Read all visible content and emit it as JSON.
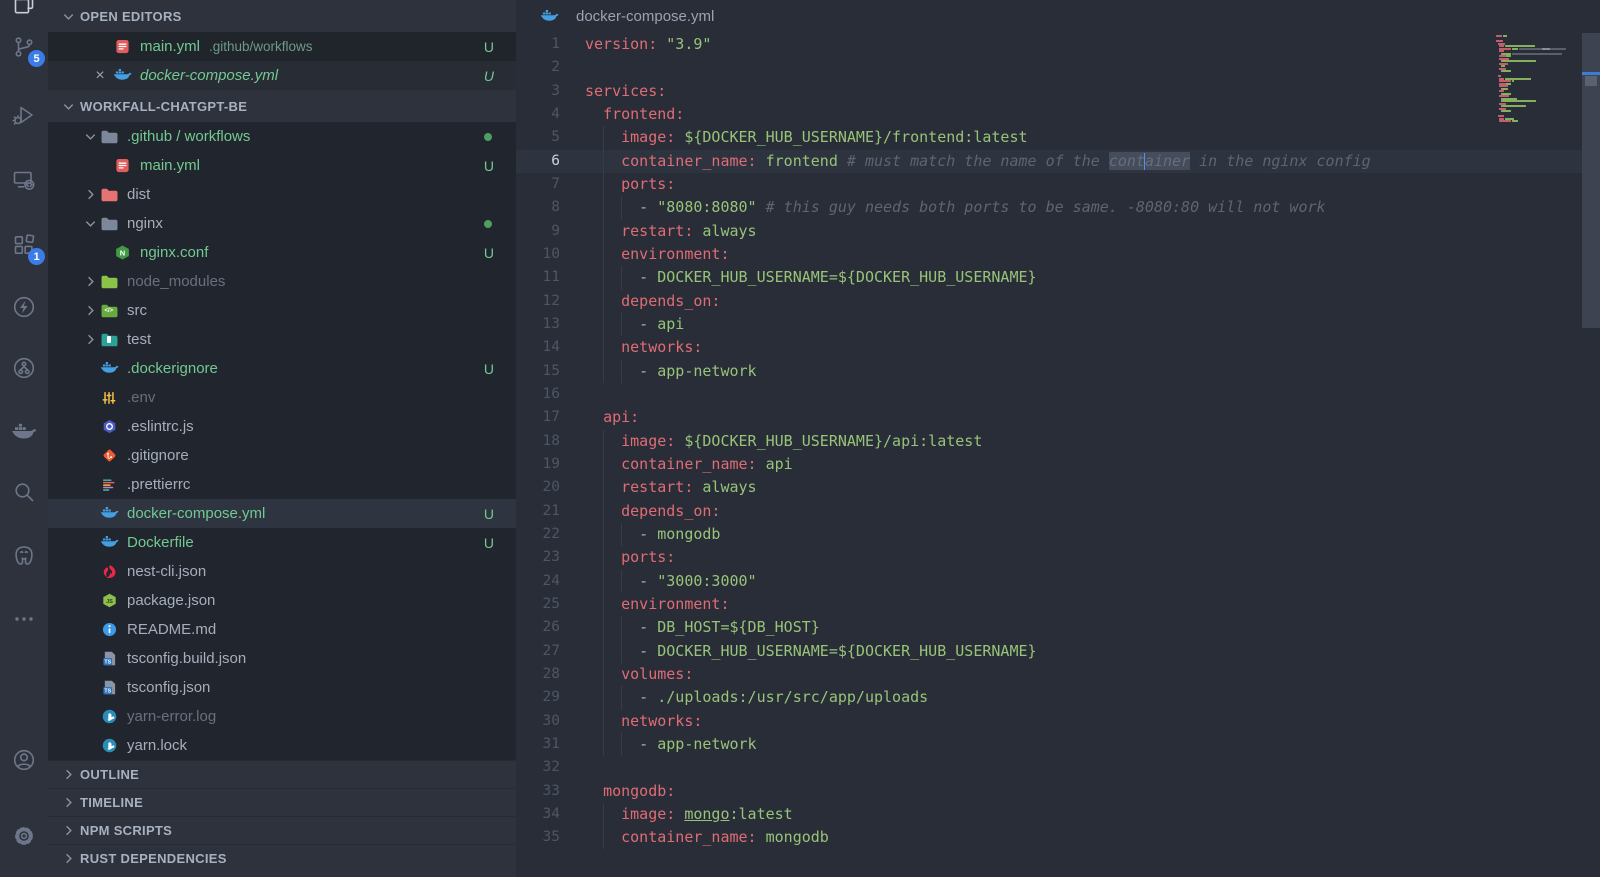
{
  "colors": {
    "accent": "#3b7de8",
    "untracked_green": "#73c991",
    "modified_dot": "#4e9e63",
    "cursor_blue": "#4e8fff",
    "key_red": "#e06c75",
    "value_green": "#98c379"
  },
  "activity_bar": {
    "items": [
      {
        "icon": "files-icon",
        "active": true
      },
      {
        "icon": "source-control-icon",
        "badge": "5"
      },
      {
        "icon": "run-debug-icon"
      },
      {
        "icon": "remote-explorer-icon"
      },
      {
        "icon": "extensions-icon",
        "badge": "1"
      },
      {
        "icon": "thunder-client-icon"
      },
      {
        "icon": "gitlens-icon"
      },
      {
        "icon": "docker-icon"
      },
      {
        "icon": "search-icon"
      },
      {
        "icon": "postgresql-icon"
      },
      {
        "icon": "more-icon"
      },
      {
        "icon": "account-icon"
      },
      {
        "icon": "settings-gear-icon"
      }
    ]
  },
  "sidebar": {
    "open_editors_header": "OPEN EDITORS",
    "project_header": "WORKFALL-CHATGPT-BE",
    "close_glyph": "×",
    "open_editors": [
      {
        "name": "main.yml",
        "description": ".github/workflows",
        "icon": "yaml",
        "badge": "U",
        "state": "untracked"
      },
      {
        "name": "docker-compose.yml",
        "icon": "docker",
        "badge": "U",
        "state": "untracked",
        "italic": true,
        "active": true,
        "closable": true
      }
    ],
    "tree": [
      {
        "label": ".github / workflows",
        "type": "folder",
        "icon": "folder-github",
        "expanded": true,
        "dot": true,
        "state": "untracked",
        "depth": 0
      },
      {
        "label": "main.yml",
        "type": "file",
        "icon": "yaml",
        "badge": "U",
        "state": "untracked",
        "depth": 1
      },
      {
        "label": "dist",
        "type": "folder",
        "icon": "folder-dist",
        "expanded": false,
        "state": "normal",
        "depth": 0
      },
      {
        "label": "nginx",
        "type": "folder",
        "icon": "folder-nginx",
        "expanded": true,
        "dot": true,
        "state": "normal",
        "depth": 0
      },
      {
        "label": "nginx.conf",
        "type": "file",
        "icon": "nginx",
        "badge": "U",
        "state": "untracked",
        "depth": 1
      },
      {
        "label": "node_modules",
        "type": "folder",
        "icon": "folder-node",
        "expanded": false,
        "state": "ignored",
        "depth": 0
      },
      {
        "label": "src",
        "type": "folder",
        "icon": "folder-src",
        "expanded": false,
        "state": "normal",
        "depth": 0
      },
      {
        "label": "test",
        "type": "folder",
        "icon": "folder-test",
        "expanded": false,
        "state": "normal",
        "depth": 0
      },
      {
        "label": ".dockerignore",
        "type": "file",
        "icon": "docker",
        "badge": "U",
        "state": "untracked",
        "depth": 0
      },
      {
        "label": ".env",
        "type": "file",
        "icon": "env",
        "state": "ignored",
        "depth": 0
      },
      {
        "label": ".eslintrc.js",
        "type": "file",
        "icon": "eslint",
        "state": "normal",
        "depth": 0
      },
      {
        "label": ".gitignore",
        "type": "file",
        "icon": "git",
        "state": "normal",
        "depth": 0
      },
      {
        "label": ".prettierrc",
        "type": "file",
        "icon": "prettier",
        "state": "normal",
        "depth": 0
      },
      {
        "label": "docker-compose.yml",
        "type": "file",
        "icon": "docker",
        "badge": "U",
        "state": "untracked",
        "selected": true,
        "depth": 0
      },
      {
        "label": "Dockerfile",
        "type": "file",
        "icon": "docker",
        "badge": "U",
        "state": "untracked",
        "depth": 0
      },
      {
        "label": "nest-cli.json",
        "type": "file",
        "icon": "nest",
        "state": "normal",
        "depth": 0
      },
      {
        "label": "package.json",
        "type": "file",
        "icon": "node",
        "state": "normal",
        "depth": 0
      },
      {
        "label": "README.md",
        "type": "file",
        "icon": "readme",
        "state": "normal",
        "depth": 0
      },
      {
        "label": "tsconfig.build.json",
        "type": "file",
        "icon": "ts",
        "state": "normal",
        "depth": 0
      },
      {
        "label": "tsconfig.json",
        "type": "file",
        "icon": "ts",
        "state": "normal",
        "depth": 0
      },
      {
        "label": "yarn-error.log",
        "type": "file",
        "icon": "yarn",
        "state": "ignored",
        "depth": 0
      },
      {
        "label": "yarn.lock",
        "type": "file",
        "icon": "yarn",
        "state": "normal",
        "depth": 0
      }
    ],
    "panels": [
      {
        "label": "OUTLINE"
      },
      {
        "label": "TIMELINE"
      },
      {
        "label": "NPM SCRIPTS"
      },
      {
        "label": "RUST DEPENDENCIES"
      }
    ]
  },
  "editor": {
    "title": {
      "filename": "docker-compose.yml",
      "icon": "docker"
    },
    "active_line": 6,
    "code_lines": [
      {
        "n": 1,
        "tokens": [
          [
            "version:",
            "k"
          ],
          [
            " ",
            "p"
          ],
          [
            "\"3.9\"",
            "g"
          ]
        ]
      },
      {
        "n": 2,
        "tokens": []
      },
      {
        "n": 3,
        "tokens": [
          [
            "services:",
            "k"
          ]
        ]
      },
      {
        "n": 4,
        "tokens": [
          [
            "  ",
            "p"
          ],
          [
            "frontend:",
            "k"
          ]
        ]
      },
      {
        "n": 5,
        "tokens": [
          [
            "    ",
            "p"
          ],
          [
            "image:",
            "k"
          ],
          [
            " ",
            "p"
          ],
          [
            "${DOCKER_HUB_USERNAME}/frontend:latest",
            "g"
          ]
        ]
      },
      {
        "n": 6,
        "tokens": [
          [
            "    ",
            "p"
          ],
          [
            "container_name:",
            "k"
          ],
          [
            " ",
            "p"
          ],
          [
            "frontend",
            "g"
          ],
          [
            " ",
            "p"
          ],
          [
            "# must match the name of the ",
            "c"
          ],
          [
            "cont",
            "chl"
          ],
          [
            "",
            "cursor"
          ],
          [
            "ainer",
            "chl"
          ],
          [
            " in the nginx config",
            "c"
          ]
        ]
      },
      {
        "n": 7,
        "tokens": [
          [
            "    ",
            "p"
          ],
          [
            "ports:",
            "k"
          ]
        ]
      },
      {
        "n": 8,
        "tokens": [
          [
            "      - ",
            "p"
          ],
          [
            "\"8080:8080\"",
            "g"
          ],
          [
            " ",
            "p"
          ],
          [
            "# this guy needs both ports to be same. -8080:80 will not work",
            "c"
          ]
        ]
      },
      {
        "n": 9,
        "tokens": [
          [
            "    ",
            "p"
          ],
          [
            "restart:",
            "k"
          ],
          [
            " ",
            "p"
          ],
          [
            "always",
            "g"
          ]
        ]
      },
      {
        "n": 10,
        "tokens": [
          [
            "    ",
            "p"
          ],
          [
            "environment:",
            "k"
          ]
        ]
      },
      {
        "n": 11,
        "tokens": [
          [
            "      - ",
            "p"
          ],
          [
            "DOCKER_HUB_USERNAME=${DOCKER_HUB_USERNAME}",
            "g"
          ]
        ]
      },
      {
        "n": 12,
        "tokens": [
          [
            "    ",
            "p"
          ],
          [
            "depends_on:",
            "k"
          ]
        ]
      },
      {
        "n": 13,
        "tokens": [
          [
            "      - ",
            "p"
          ],
          [
            "api",
            "g"
          ]
        ]
      },
      {
        "n": 14,
        "tokens": [
          [
            "    ",
            "p"
          ],
          [
            "networks:",
            "k"
          ]
        ]
      },
      {
        "n": 15,
        "tokens": [
          [
            "      - ",
            "p"
          ],
          [
            "app-network",
            "g"
          ]
        ]
      },
      {
        "n": 16,
        "tokens": []
      },
      {
        "n": 17,
        "tokens": [
          [
            "  ",
            "p"
          ],
          [
            "api:",
            "k"
          ]
        ]
      },
      {
        "n": 18,
        "tokens": [
          [
            "    ",
            "p"
          ],
          [
            "image:",
            "k"
          ],
          [
            " ",
            "p"
          ],
          [
            "${DOCKER_HUB_USERNAME}/api:latest",
            "g"
          ]
        ]
      },
      {
        "n": 19,
        "tokens": [
          [
            "    ",
            "p"
          ],
          [
            "container_name:",
            "k"
          ],
          [
            " ",
            "p"
          ],
          [
            "api",
            "g"
          ]
        ]
      },
      {
        "n": 20,
        "tokens": [
          [
            "    ",
            "p"
          ],
          [
            "restart:",
            "k"
          ],
          [
            " ",
            "p"
          ],
          [
            "always",
            "g"
          ]
        ]
      },
      {
        "n": 21,
        "tokens": [
          [
            "    ",
            "p"
          ],
          [
            "depends_on:",
            "k"
          ]
        ]
      },
      {
        "n": 22,
        "tokens": [
          [
            "      - ",
            "p"
          ],
          [
            "mongodb",
            "g"
          ]
        ]
      },
      {
        "n": 23,
        "tokens": [
          [
            "    ",
            "p"
          ],
          [
            "ports:",
            "k"
          ]
        ]
      },
      {
        "n": 24,
        "tokens": [
          [
            "      - ",
            "p"
          ],
          [
            "\"3000:3000\"",
            "g"
          ]
        ]
      },
      {
        "n": 25,
        "tokens": [
          [
            "    ",
            "p"
          ],
          [
            "environment:",
            "k"
          ]
        ]
      },
      {
        "n": 26,
        "tokens": [
          [
            "      - ",
            "p"
          ],
          [
            "DB_HOST=${DB_HOST}",
            "g"
          ]
        ]
      },
      {
        "n": 27,
        "tokens": [
          [
            "      - ",
            "p"
          ],
          [
            "DOCKER_HUB_USERNAME=${DOCKER_HUB_USERNAME}",
            "g"
          ]
        ]
      },
      {
        "n": 28,
        "tokens": [
          [
            "    ",
            "p"
          ],
          [
            "volumes:",
            "k"
          ]
        ]
      },
      {
        "n": 29,
        "tokens": [
          [
            "      - ",
            "p"
          ],
          [
            "./uploads:/usr/src/app/uploads",
            "g"
          ]
        ]
      },
      {
        "n": 30,
        "tokens": [
          [
            "    ",
            "p"
          ],
          [
            "networks:",
            "k"
          ]
        ]
      },
      {
        "n": 31,
        "tokens": [
          [
            "      - ",
            "p"
          ],
          [
            "app-network",
            "g"
          ]
        ]
      },
      {
        "n": 32,
        "tokens": []
      },
      {
        "n": 33,
        "tokens": [
          [
            "  ",
            "p"
          ],
          [
            "mongodb:",
            "k"
          ]
        ]
      },
      {
        "n": 34,
        "tokens": [
          [
            "    ",
            "p"
          ],
          [
            "image:",
            "k"
          ],
          [
            " ",
            "p"
          ],
          [
            "mongo",
            "gu"
          ],
          [
            ":latest",
            "g"
          ]
        ]
      },
      {
        "n": 35,
        "tokens": [
          [
            "    ",
            "p"
          ],
          [
            "container_name:",
            "k"
          ],
          [
            " ",
            "p"
          ],
          [
            "mongodb",
            "g"
          ]
        ]
      }
    ]
  }
}
